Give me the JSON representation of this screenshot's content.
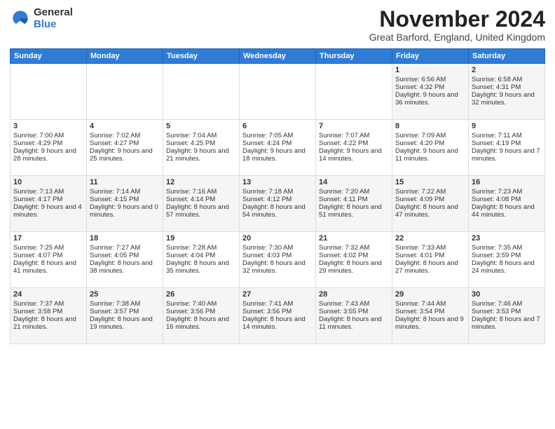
{
  "logo": {
    "general": "General",
    "blue": "Blue"
  },
  "title": "November 2024",
  "location": "Great Barford, England, United Kingdom",
  "headers": [
    "Sunday",
    "Monday",
    "Tuesday",
    "Wednesday",
    "Thursday",
    "Friday",
    "Saturday"
  ],
  "weeks": [
    [
      {
        "day": "",
        "sunrise": "",
        "sunset": "",
        "daylight": ""
      },
      {
        "day": "",
        "sunrise": "",
        "sunset": "",
        "daylight": ""
      },
      {
        "day": "",
        "sunrise": "",
        "sunset": "",
        "daylight": ""
      },
      {
        "day": "",
        "sunrise": "",
        "sunset": "",
        "daylight": ""
      },
      {
        "day": "",
        "sunrise": "",
        "sunset": "",
        "daylight": ""
      },
      {
        "day": "1",
        "sunrise": "Sunrise: 6:56 AM",
        "sunset": "Sunset: 4:32 PM",
        "daylight": "Daylight: 9 hours and 36 minutes."
      },
      {
        "day": "2",
        "sunrise": "Sunrise: 6:58 AM",
        "sunset": "Sunset: 4:31 PM",
        "daylight": "Daylight: 9 hours and 32 minutes."
      }
    ],
    [
      {
        "day": "3",
        "sunrise": "Sunrise: 7:00 AM",
        "sunset": "Sunset: 4:29 PM",
        "daylight": "Daylight: 9 hours and 28 minutes."
      },
      {
        "day": "4",
        "sunrise": "Sunrise: 7:02 AM",
        "sunset": "Sunset: 4:27 PM",
        "daylight": "Daylight: 9 hours and 25 minutes."
      },
      {
        "day": "5",
        "sunrise": "Sunrise: 7:04 AM",
        "sunset": "Sunset: 4:25 PM",
        "daylight": "Daylight: 9 hours and 21 minutes."
      },
      {
        "day": "6",
        "sunrise": "Sunrise: 7:05 AM",
        "sunset": "Sunset: 4:24 PM",
        "daylight": "Daylight: 9 hours and 18 minutes."
      },
      {
        "day": "7",
        "sunrise": "Sunrise: 7:07 AM",
        "sunset": "Sunset: 4:22 PM",
        "daylight": "Daylight: 9 hours and 14 minutes."
      },
      {
        "day": "8",
        "sunrise": "Sunrise: 7:09 AM",
        "sunset": "Sunset: 4:20 PM",
        "daylight": "Daylight: 9 hours and 11 minutes."
      },
      {
        "day": "9",
        "sunrise": "Sunrise: 7:11 AM",
        "sunset": "Sunset: 4:19 PM",
        "daylight": "Daylight: 9 hours and 7 minutes."
      }
    ],
    [
      {
        "day": "10",
        "sunrise": "Sunrise: 7:13 AM",
        "sunset": "Sunset: 4:17 PM",
        "daylight": "Daylight: 9 hours and 4 minutes."
      },
      {
        "day": "11",
        "sunrise": "Sunrise: 7:14 AM",
        "sunset": "Sunset: 4:15 PM",
        "daylight": "Daylight: 9 hours and 0 minutes."
      },
      {
        "day": "12",
        "sunrise": "Sunrise: 7:16 AM",
        "sunset": "Sunset: 4:14 PM",
        "daylight": "Daylight: 8 hours and 57 minutes."
      },
      {
        "day": "13",
        "sunrise": "Sunrise: 7:18 AM",
        "sunset": "Sunset: 4:12 PM",
        "daylight": "Daylight: 8 hours and 54 minutes."
      },
      {
        "day": "14",
        "sunrise": "Sunrise: 7:20 AM",
        "sunset": "Sunset: 4:11 PM",
        "daylight": "Daylight: 8 hours and 51 minutes."
      },
      {
        "day": "15",
        "sunrise": "Sunrise: 7:22 AM",
        "sunset": "Sunset: 4:09 PM",
        "daylight": "Daylight: 8 hours and 47 minutes."
      },
      {
        "day": "16",
        "sunrise": "Sunrise: 7:23 AM",
        "sunset": "Sunset: 4:08 PM",
        "daylight": "Daylight: 8 hours and 44 minutes."
      }
    ],
    [
      {
        "day": "17",
        "sunrise": "Sunrise: 7:25 AM",
        "sunset": "Sunset: 4:07 PM",
        "daylight": "Daylight: 8 hours and 41 minutes."
      },
      {
        "day": "18",
        "sunrise": "Sunrise: 7:27 AM",
        "sunset": "Sunset: 4:05 PM",
        "daylight": "Daylight: 8 hours and 38 minutes."
      },
      {
        "day": "19",
        "sunrise": "Sunrise: 7:28 AM",
        "sunset": "Sunset: 4:04 PM",
        "daylight": "Daylight: 8 hours and 35 minutes."
      },
      {
        "day": "20",
        "sunrise": "Sunrise: 7:30 AM",
        "sunset": "Sunset: 4:03 PM",
        "daylight": "Daylight: 8 hours and 32 minutes."
      },
      {
        "day": "21",
        "sunrise": "Sunrise: 7:32 AM",
        "sunset": "Sunset: 4:02 PM",
        "daylight": "Daylight: 8 hours and 29 minutes."
      },
      {
        "day": "22",
        "sunrise": "Sunrise: 7:33 AM",
        "sunset": "Sunset: 4:01 PM",
        "daylight": "Daylight: 8 hours and 27 minutes."
      },
      {
        "day": "23",
        "sunrise": "Sunrise: 7:35 AM",
        "sunset": "Sunset: 3:59 PM",
        "daylight": "Daylight: 8 hours and 24 minutes."
      }
    ],
    [
      {
        "day": "24",
        "sunrise": "Sunrise: 7:37 AM",
        "sunset": "Sunset: 3:58 PM",
        "daylight": "Daylight: 8 hours and 21 minutes."
      },
      {
        "day": "25",
        "sunrise": "Sunrise: 7:38 AM",
        "sunset": "Sunset: 3:57 PM",
        "daylight": "Daylight: 8 hours and 19 minutes."
      },
      {
        "day": "26",
        "sunrise": "Sunrise: 7:40 AM",
        "sunset": "Sunset: 3:56 PM",
        "daylight": "Daylight: 8 hours and 16 minutes."
      },
      {
        "day": "27",
        "sunrise": "Sunrise: 7:41 AM",
        "sunset": "Sunset: 3:56 PM",
        "daylight": "Daylight: 8 hours and 14 minutes."
      },
      {
        "day": "28",
        "sunrise": "Sunrise: 7:43 AM",
        "sunset": "Sunset: 3:55 PM",
        "daylight": "Daylight: 8 hours and 11 minutes."
      },
      {
        "day": "29",
        "sunrise": "Sunrise: 7:44 AM",
        "sunset": "Sunset: 3:54 PM",
        "daylight": "Daylight: 8 hours and 9 minutes."
      },
      {
        "day": "30",
        "sunrise": "Sunrise: 7:46 AM",
        "sunset": "Sunset: 3:53 PM",
        "daylight": "Daylight: 8 hours and 7 minutes."
      }
    ]
  ]
}
